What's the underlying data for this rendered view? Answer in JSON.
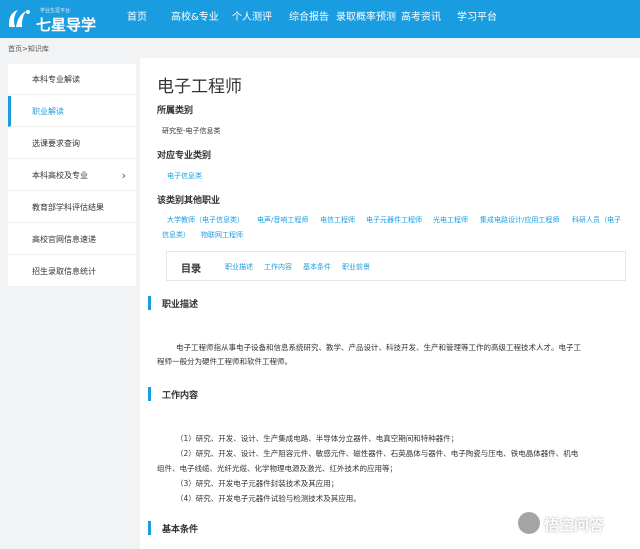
{
  "header": {
    "logo_slogan": "学业生涯平台",
    "logo_text": "七星导学",
    "nav": [
      "首页",
      "高校&专业",
      "个人测评",
      "综合报告",
      "录取概率预测",
      "高考资讯",
      "学习平台"
    ]
  },
  "breadcrumb": "首页>知识库",
  "sidebar": {
    "items": [
      {
        "label": "本科专业解读"
      },
      {
        "label": "职业解读"
      },
      {
        "label": "选课要求查询"
      },
      {
        "label": "本科高校及专业"
      },
      {
        "label": "教育部学科评估结果"
      },
      {
        "label": "高校官网信息速递"
      },
      {
        "label": "招生录取信息统计"
      }
    ]
  },
  "main": {
    "title": "电子工程师",
    "category_heading": "所属类别",
    "category_value": "研究型-电子信息类",
    "major_heading": "对应专业类别",
    "major_value": "电子信息类",
    "other_heading": "该类别其他职业",
    "other_jobs_row1": [
      "大学教师（电子信息类）",
      "电声/音响工程师",
      "电信工程师",
      "电子元器件工程师",
      "光电工程师",
      "集成电路设计/应用工程师",
      "科研人员（电子"
    ],
    "other_jobs_row2": [
      "信息类）",
      "物联网工程师"
    ],
    "toc": {
      "title": "目录",
      "links": [
        "职业描述",
        "工作内容",
        "基本条件",
        "职业前景"
      ]
    },
    "sections": {
      "desc_title": "职业描述",
      "desc_line1": "电子工程师指从事电子设备和信息系统研究、教学、产品设计、科技开发、生产和管理等工作的高级工程技术人才。电子工",
      "desc_line2": "程师一般分为硬件工程师和软件工程师。",
      "work_title": "工作内容",
      "work_lines": [
        "（1）研究、开发、设计、生产集成电路、半导体分立器件、电真空期间和特种器件；",
        "（2）研究、开发、设计、生产阻容元件、敏感元件、磁性器件、石英晶体与器件、电子陶瓷与压电、铁电晶体器件、机电",
        "组件、电子线缆、光纤光缆、化学物理电源及激光、红外技术的应用等；",
        "（3）研究、开发电子元器件封装技术及其应用；",
        "（4）研究、开发电子元器件试验与检测技术及其应用。"
      ],
      "basic_title": "基本条件"
    }
  },
  "watermark": "悟空问答",
  "colors": {
    "brand": "#1a9de0",
    "background": "#f2f3f5"
  }
}
